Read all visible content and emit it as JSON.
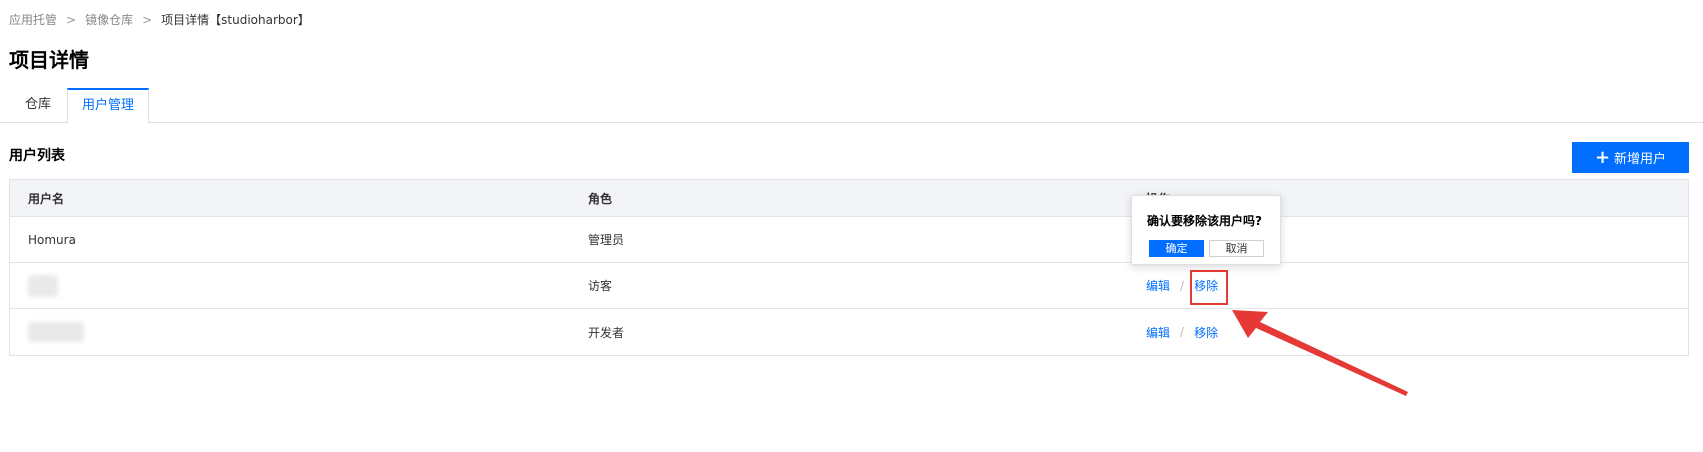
{
  "breadcrumb": {
    "items": [
      "应用托管",
      "镜像仓库",
      "项目详情【studioharbor】"
    ],
    "separator": ">"
  },
  "page_title": "项目详情",
  "tabs": [
    {
      "label": "仓库",
      "active": false
    },
    {
      "label": "用户管理",
      "active": true
    }
  ],
  "section_title": "用户列表",
  "add_button": {
    "icon": "plus-icon",
    "label": "新增用户"
  },
  "table": {
    "headers": [
      "用户名",
      "角色",
      "操作"
    ],
    "rows": [
      {
        "username": "Homura",
        "role": "管理员",
        "actions": []
      },
      {
        "username": "",
        "role": "访客",
        "actions": [
          "编辑",
          "移除"
        ]
      },
      {
        "username": "",
        "role": "开发者",
        "actions": [
          "编辑",
          "移除"
        ]
      }
    ],
    "action_separator": "/"
  },
  "popover": {
    "question": "确认要移除该用户吗?",
    "confirm_label": "确定",
    "cancel_label": "取消"
  },
  "colors": {
    "primary": "#006eff",
    "annotation": "#e53935",
    "table_header_bg": "#f2f4f8"
  }
}
